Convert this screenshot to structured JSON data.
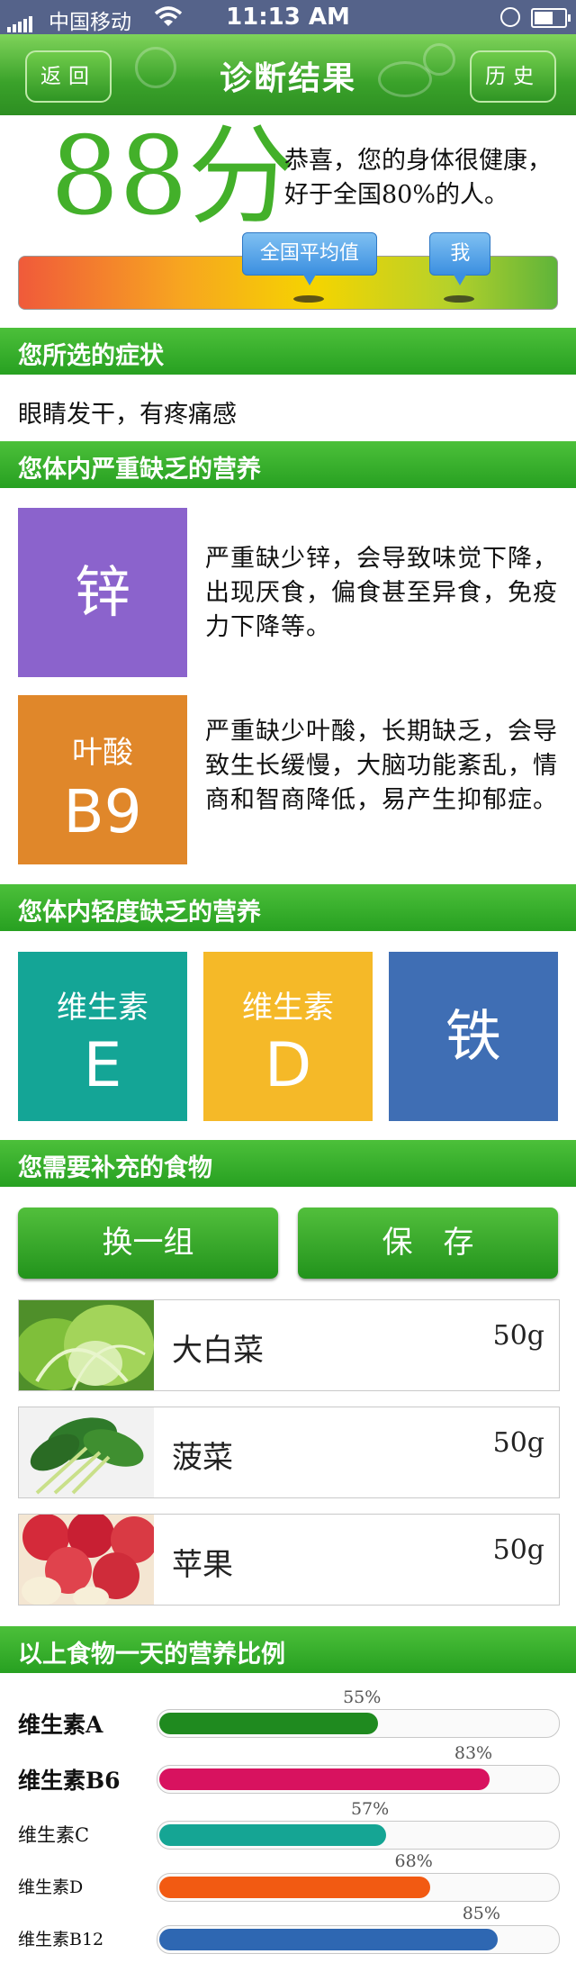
{
  "status_bar": {
    "carrier": "中国移动",
    "time": "11:13 AM"
  },
  "nav": {
    "back_label": "返回",
    "title": "诊断结果",
    "history_label": "历史"
  },
  "score": {
    "value": "88分",
    "message": "恭喜，您的身体很健康，好于全国80%的人。"
  },
  "gauge": {
    "avg_label": "全国平均值",
    "me_label": "我",
    "avg_fraction": 0.54,
    "me_fraction": 0.82
  },
  "symptoms": {
    "header": "您所选的症状",
    "text": "眼睛发干，有疼痛感"
  },
  "severe": {
    "header": "您体内严重缺乏的营养",
    "items": [
      {
        "tile_line1": "锌",
        "tile_line2": "",
        "color": "#8b63cc",
        "desc": "严重缺少锌，会导致味觉下降，出现厌食，偏食甚至异食，免疫力下降等。"
      },
      {
        "tile_line1": "叶酸",
        "tile_line2": "B9",
        "color": "#e0872a",
        "desc": "严重缺少叶酸，长期缺乏，会导致生长缓慢，大脑功能紊乱，情商和智商降低，易产生抑郁症。"
      }
    ]
  },
  "mild": {
    "header": "您体内轻度缺乏的营养",
    "items": [
      {
        "line1": "维生素",
        "line2": "E",
        "color": "#14a596"
      },
      {
        "line1": "维生素",
        "line2": "D",
        "color": "#f5b928"
      },
      {
        "line1": "铁",
        "line2": "",
        "color": "#3f6eb4"
      }
    ]
  },
  "foods": {
    "header": "您需要补充的食物",
    "change_label": "换一组",
    "save_label": "保　存",
    "items": [
      {
        "name": "大白菜",
        "amount": "50g",
        "icon": "cabbage-photo"
      },
      {
        "name": "菠菜",
        "amount": "50g",
        "icon": "spinach-photo"
      },
      {
        "name": "苹果",
        "amount": "50g",
        "icon": "apple-photo"
      }
    ]
  },
  "nutrition": {
    "header": "以上食物一天的营养比例",
    "items": [
      {
        "name": "维生素A",
        "percent_label": "55%",
        "value": 55,
        "color": "#1f8a1f"
      },
      {
        "name": "维生素B6",
        "percent_label": "83%",
        "value": 83,
        "color": "#d8125f"
      },
      {
        "name": "维生素C",
        "percent_label": "57%",
        "value": 57,
        "color": "#15a594"
      },
      {
        "name": "维生素D",
        "percent_label": "68%",
        "value": 68,
        "color": "#f25a12"
      },
      {
        "name": "维生素B12",
        "percent_label": "85%",
        "value": 85,
        "color": "#2e67b2"
      }
    ]
  }
}
